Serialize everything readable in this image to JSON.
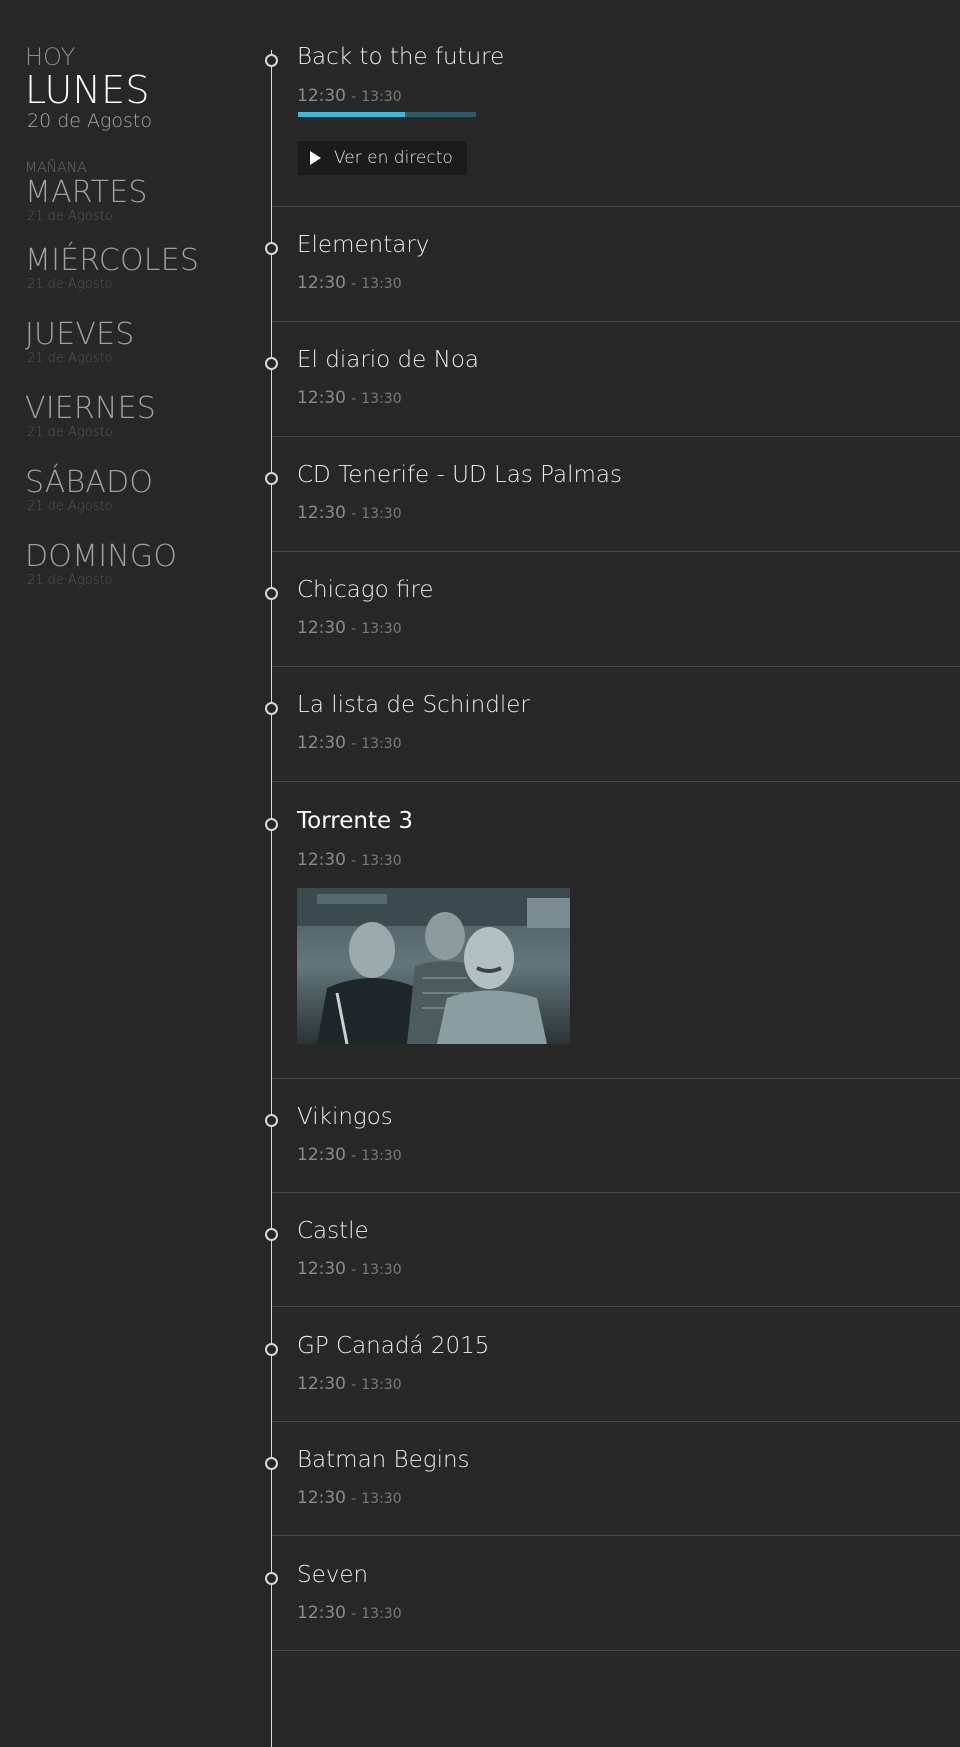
{
  "sidebar": {
    "today_label": "HOY",
    "today_day": "LUNES",
    "today_date": "20 de Agosto",
    "tomorrow_label": "MAÑANA",
    "days": [
      {
        "name": "MARTES",
        "date": "21 de Agosto"
      },
      {
        "name": "MIÉRCOLES",
        "date": "21 de Agosto"
      },
      {
        "name": "JUEVES",
        "date": "21 de Agosto"
      },
      {
        "name": "VIERNES",
        "date": "21 de Agosto"
      },
      {
        "name": "SÁBADO",
        "date": "21 de Agosto"
      },
      {
        "name": "DOMINGO",
        "date": "21 de Agosto"
      }
    ]
  },
  "programs": [
    {
      "title": "Back to the future",
      "start": "12:30",
      "sep": "-",
      "end": "13:30",
      "progress": 0.6,
      "live_button": "Ver en directo"
    },
    {
      "title": "Elementary",
      "start": "12:30",
      "sep": "-",
      "end": "13:30"
    },
    {
      "title": "El diario de Noa",
      "start": "12:30",
      "sep": "-",
      "end": "13:30"
    },
    {
      "title": "CD Tenerife - UD Las Palmas",
      "start": "12:30",
      "sep": "-",
      "end": "13:30"
    },
    {
      "title": "Chicago fire",
      "start": "12:30",
      "sep": "-",
      "end": "13:30"
    },
    {
      "title": "La lista de Schindler",
      "start": "12:30",
      "sep": "-",
      "end": "13:30"
    },
    {
      "title": "Torrente 3",
      "start": "12:30",
      "sep": "-",
      "end": "13:30"
    },
    {
      "title": "Vikingos",
      "start": "12:30",
      "sep": "-",
      "end": "13:30"
    },
    {
      "title": "Castle",
      "start": "12:30",
      "sep": "-",
      "end": "13:30"
    },
    {
      "title": "GP Canadá 2015",
      "start": "12:30",
      "sep": "-",
      "end": "13:30"
    },
    {
      "title": "Batman Begins",
      "start": "12:30",
      "sep": "-",
      "end": "13:30"
    },
    {
      "title": "Seven",
      "start": "12:30",
      "sep": "-",
      "end": "13:30"
    }
  ],
  "colors": {
    "background": "#272727",
    "accent": "#3fb8d8",
    "progress_track": "#2e5a66"
  }
}
